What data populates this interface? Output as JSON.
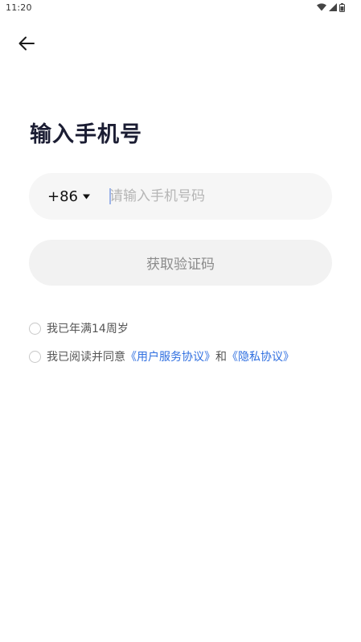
{
  "status_bar": {
    "time": "11:20",
    "icons": [
      "wifi-icon",
      "signal-icon",
      "battery-icon"
    ]
  },
  "header": {
    "back_icon": "arrow-left-icon"
  },
  "main": {
    "title": "输入手机号",
    "country_code": "+86",
    "phone_placeholder": "请输入手机号码",
    "phone_value": "",
    "get_code_label": "获取验证码"
  },
  "consents": {
    "age_label": "我已年满14周岁",
    "agree_prefix": "我已阅读并同意",
    "user_agreement": "《用户服务协议》",
    "agree_and": "和",
    "privacy_policy": "《隐私协议》"
  },
  "colors": {
    "title": "#1b1d33",
    "link": "#2f6fe0",
    "field_bg": "#f6f6f6",
    "button_bg": "#f2f2f2",
    "button_text": "#8a8a8a"
  }
}
